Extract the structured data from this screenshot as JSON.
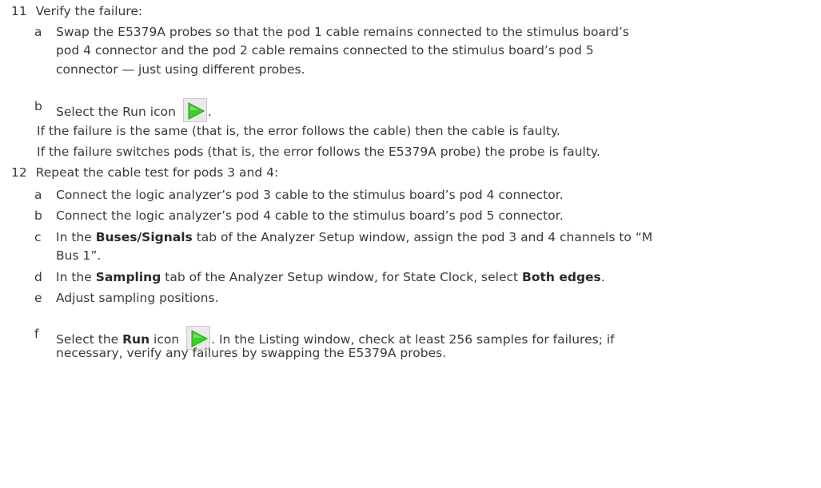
{
  "step11": {
    "num": "11",
    "text": "Verify the failure:",
    "a": {
      "letter": "a",
      "line1": "Swap the E5379A probes so that the pod 1 cable remains connected to the stimulus board’s",
      "line2": "pod 4 connector and the pod 2 cable remains connected to the stimulus board’s pod 5",
      "line3": "connector — just using different probes."
    },
    "b": {
      "letter": "b",
      "text": "Select the Run icon",
      "after": "."
    },
    "note1": "If the failure is the same (that is, the error follows the cable) then the cable is faulty.",
    "note2": "If the failure switches pods (that is, the error follows the E5379A probe) the probe is faulty."
  },
  "step12": {
    "num": "12",
    "text": "Repeat the cable test for pods 3 and 4:",
    "a": {
      "letter": "a",
      "text": "Connect the logic analyzer’s pod 3 cable to the stimulus board’s pod 4 connector."
    },
    "b": {
      "letter": "b",
      "text": "Connect the logic analyzer’s pod 4 cable to the stimulus board’s pod 5 connector."
    },
    "c": {
      "letter": "c",
      "pre": "In the ",
      "bold": "Buses/Signals",
      "post": " tab of the Analyzer Setup window, assign the pod 3 and 4 channels to “M",
      "line2": "Bus 1”."
    },
    "d": {
      "letter": "d",
      "pre": "In the ",
      "bold1": "Sampling",
      "mid": " tab of the Analyzer Setup window, for State Clock, select ",
      "bold2": "Both edges",
      "post": "."
    },
    "e": {
      "letter": "e",
      "text": "Adjust sampling positions."
    },
    "f": {
      "letter": "f",
      "pre": "Select the ",
      "bold": "Run",
      "post": " icon",
      "after": ". In the Listing window, check at least 256 samples for failures; if",
      "line2": "necessary, verify any failures by swapping the E5379A probes."
    }
  },
  "colors": {
    "run_icon_green": "#3ccf2a",
    "run_icon_bg": "#eaeaea"
  }
}
